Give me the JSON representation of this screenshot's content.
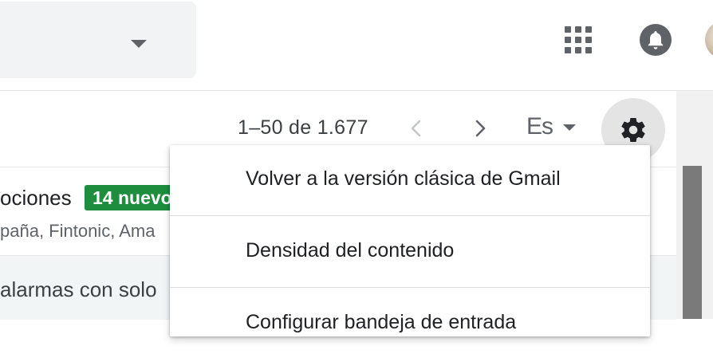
{
  "toolbar": {
    "pagination": "1–50 de 1.677",
    "language_short": "Es"
  },
  "inbox": {
    "category_title": "ociones",
    "new_badge": "14 nuevo",
    "category_senders": "paña, Fintonic, Ama",
    "email_snippet": "alarmas con solo"
  },
  "settings_menu": {
    "items": [
      {
        "label": "Volver a la versión clásica de Gmail"
      },
      {
        "label": "Densidad del contenido"
      },
      {
        "label": "Configurar bandeja de entrada"
      }
    ]
  },
  "colors": {
    "badge_green": "#1e8e3e",
    "icon_grey": "#5f6368",
    "search_bg": "#f1f3f4"
  },
  "icons": [
    "chevron-down-icon",
    "apps-grid-icon",
    "notifications-bell-icon",
    "chevron-left-icon",
    "chevron-right-icon",
    "settings-gear-icon"
  ]
}
